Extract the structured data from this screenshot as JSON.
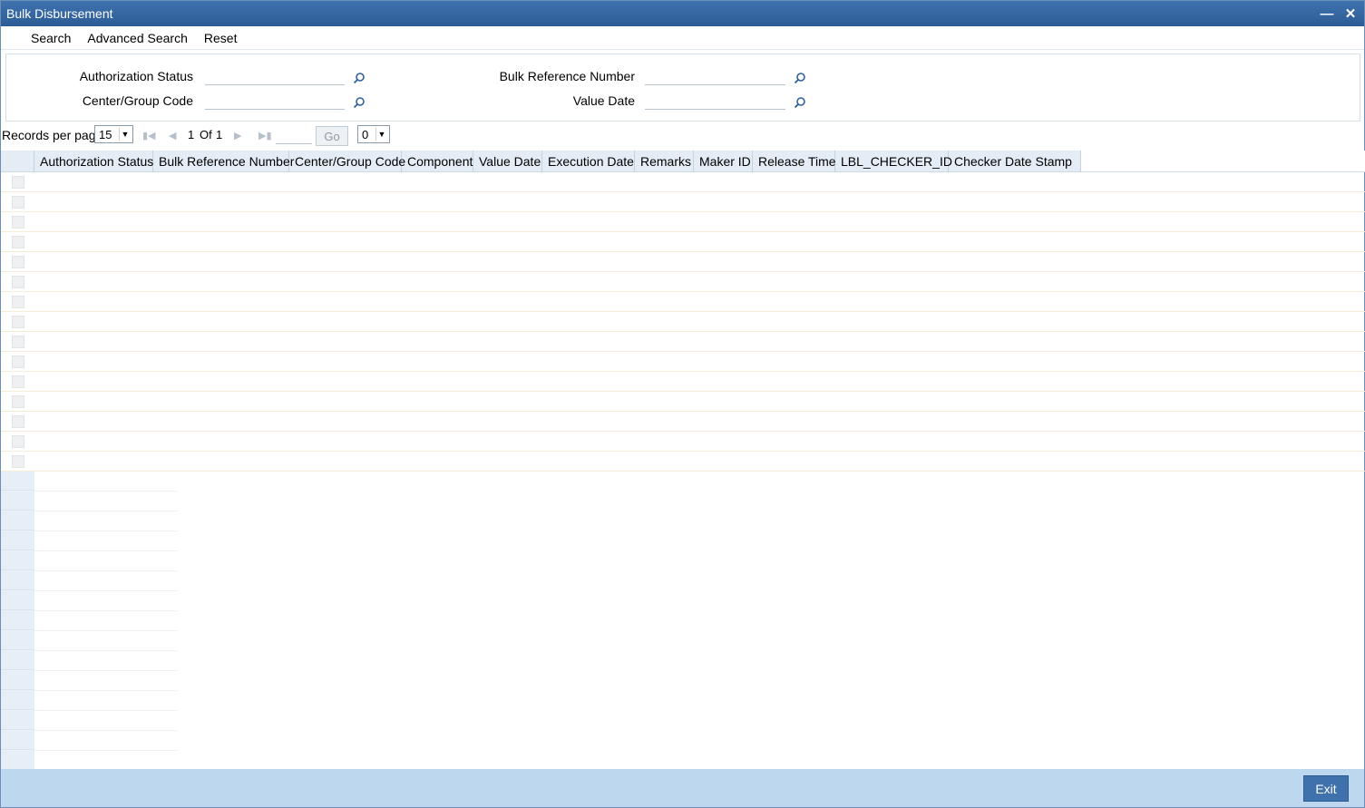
{
  "window": {
    "title": "Bulk Disbursement",
    "minimize_icon": "minimize-icon",
    "close_icon": "close-icon"
  },
  "toolbar": {
    "search_label": "Search",
    "advanced_search_label": "Advanced Search",
    "reset_label": "Reset"
  },
  "criteria": {
    "authorization_status": {
      "label": "Authorization Status",
      "value": ""
    },
    "center_group_code": {
      "label": "Center/Group Code",
      "value": ""
    },
    "bulk_reference_number": {
      "label": "Bulk Reference Number",
      "value": ""
    },
    "value_date": {
      "label": "Value Date",
      "value": ""
    },
    "lov_icon": "search-icon"
  },
  "pager": {
    "records_per_page_label": "Records per page",
    "records_per_page_value": "15",
    "current_page": "1",
    "of_label": "Of",
    "total_pages": "1",
    "goto_value": "",
    "go_label": "Go",
    "secondary_select_value": "0"
  },
  "grid": {
    "columns": [
      "Authorization Status",
      "Bulk Reference Number",
      "Center/Group Code",
      "Component",
      "Value Date",
      "Execution Date",
      "Remarks",
      "Maker ID",
      "Release Time",
      "LBL_CHECKER_ID",
      "Checker Date Stamp"
    ],
    "empty_row_count": 15
  },
  "footer": {
    "exit_label": "Exit"
  },
  "colors": {
    "title_bar": "#2f609b",
    "footer": "#bdd7ee",
    "header_bg": "#e4ecf5",
    "button": "#3f72ad"
  }
}
